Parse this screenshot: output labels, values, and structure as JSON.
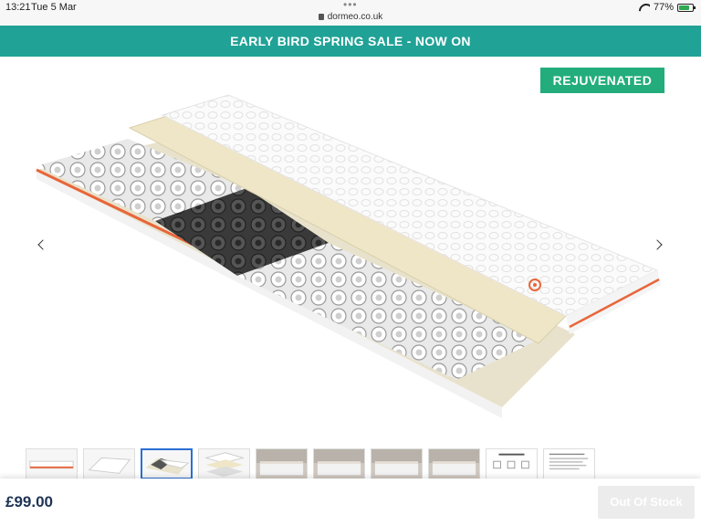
{
  "status_bar": {
    "time": "13:21",
    "date": "Tue 5 Mar",
    "url": "dormeo.co.uk",
    "battery_text": "77%",
    "battery_level": 0.77
  },
  "banner": {
    "text": "EARLY BIRD SPRING SALE - NOW ON"
  },
  "product": {
    "badge": "REJUVENATED",
    "price": "£99.00",
    "stock_button": "Out Of Stock",
    "selected_thumbnail": 3,
    "thumbnails": [
      {
        "kind": "mattress-side"
      },
      {
        "kind": "mattress-flat"
      },
      {
        "kind": "mattress-layers-cutaway"
      },
      {
        "kind": "mattress-layers-exploded"
      },
      {
        "kind": "bedroom-photo"
      },
      {
        "kind": "bedroom-photo"
      },
      {
        "kind": "bedroom-photo"
      },
      {
        "kind": "bedroom-photo"
      },
      {
        "kind": "promise-card"
      },
      {
        "kind": "text-document"
      }
    ]
  },
  "colors": {
    "banner": "#20a296",
    "badge": "#23ad7c",
    "price": "#1e3354",
    "accent_orange": "#e8663a"
  }
}
